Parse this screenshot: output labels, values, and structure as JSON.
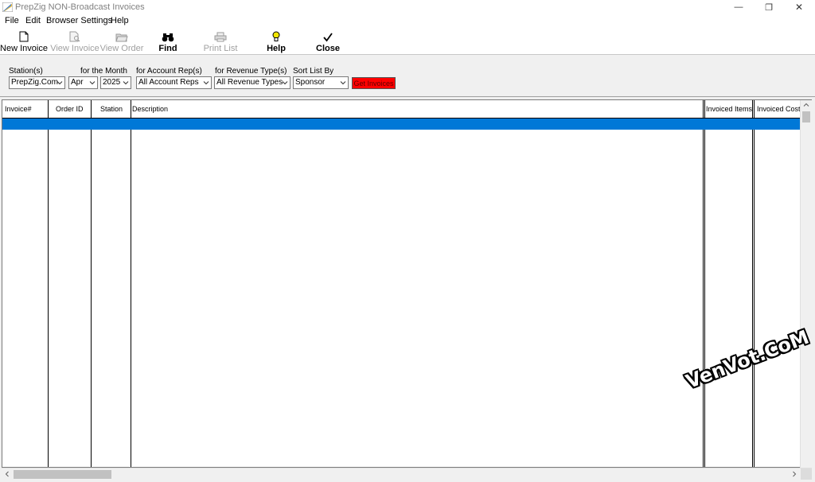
{
  "window": {
    "title": "PrepZig NON-Broadcast Invoices",
    "minimize_glyph": "—",
    "restore_glyph": "❐",
    "close_glyph": "✕"
  },
  "menu": [
    "File",
    "Edit",
    "Browser Settings",
    "Help"
  ],
  "toolbar": {
    "new_invoice": "New Invoice",
    "view_invoice": "View Invoice",
    "view_order": "View Order",
    "find": "Find",
    "print_list": "Print List",
    "help": "Help",
    "close": "Close"
  },
  "filters": {
    "stations_label": "Station(s)",
    "stations_value": "PrepZig.Com",
    "month_label": "for the Month",
    "month_value": "Apr",
    "year_value": "2025",
    "reps_label": "for Account Rep(s)",
    "reps_value": "All Account Reps",
    "revtype_label": "for Revenue Type(s)",
    "revtype_value": "All Revenue Types",
    "sort_label": "Sort List By",
    "sort_value": "Sponsor",
    "get_invoices": "Get Invoices"
  },
  "grid": {
    "columns": [
      "Invoice#",
      "Order ID",
      "Station",
      "Description",
      "Invoiced Items",
      "Invoiced Cost"
    ]
  },
  "watermark": "VenVot.CoM",
  "colors": {
    "selection": "#0078d7",
    "get_button": "#ff0000"
  },
  "icons": {
    "new_invoice": "document-icon",
    "view_invoice": "document-view-icon",
    "view_order": "folder-icon",
    "find": "binoculars-icon",
    "print_list": "printer-icon",
    "help": "lightbulb-icon",
    "close": "checkmark-icon"
  }
}
